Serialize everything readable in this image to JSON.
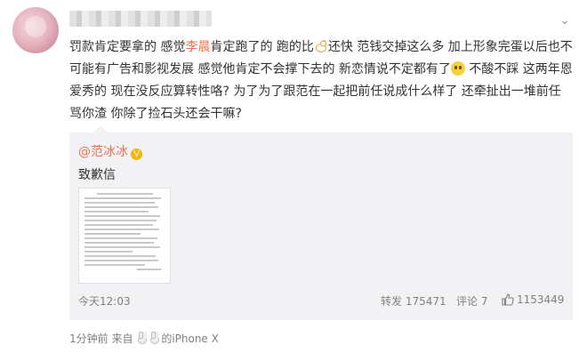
{
  "post": {
    "text_1": "罚款肯定要拿的 感觉",
    "mention": "李晨",
    "text_2": "肯定跑了的 跑的比",
    "text_3": "还快 范钱交掉这么多 加上形象完蛋以后也不可能有广告和影视发展 感觉他肯定不会撑下去的 新恋情说不定都有了",
    "text_4": " 不酸不踩 这两年恩爱秀的 现在没反应算转性咯? 为了为了跟范在一起把前任说成什么样了 还牵扯出一堆前任骂你渣 你除了捡石头还会干嘛?",
    "emoji_1": "chicken-emoji",
    "emoji_2": "smile-emoji"
  },
  "repost": {
    "author": "@范冰冰",
    "badge": "V",
    "text": "致歉信",
    "time": "今天12:03",
    "repost_label": "转发",
    "repost_count": "175471",
    "comment_label": "评论",
    "comment_count": "7",
    "like_count": "1153449"
  },
  "footer": {
    "time_ago": "1分钟前",
    "source_prefix": "来自",
    "device": "的iPhone X"
  },
  "icons": {
    "chevron": "chevron-down-icon",
    "like": "thumbs-up-icon"
  }
}
